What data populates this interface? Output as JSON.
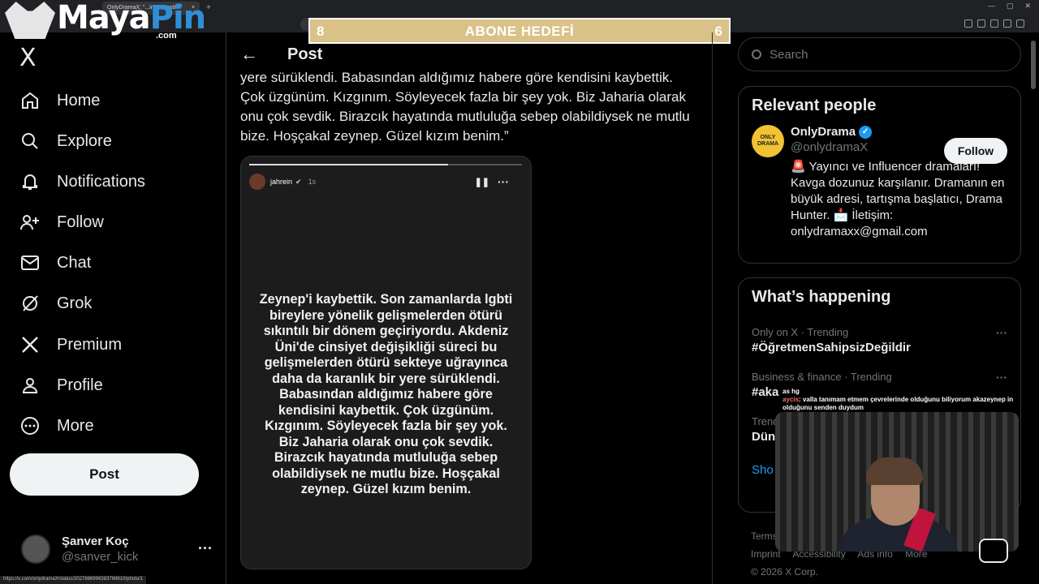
{
  "browser": {
    "tab_title": "OnlyDramaX: \"...in, travesti...\"",
    "tab_close": "×",
    "new_tab": "+",
    "status_url": "https://x.com/onlydramaX/status/2027886996383768810/photo/1"
  },
  "overlay": {
    "brand_word_a": "Maya",
    "brand_word_b": "Pin",
    "brand_domain": ".com",
    "goal_left": "8",
    "goal_title": "ABONE HEDEFİ",
    "goal_right": "6"
  },
  "nav": {
    "logo": "X",
    "items": [
      {
        "label": "Home",
        "icon": "home-icon"
      },
      {
        "label": "Explore",
        "icon": "search-icon"
      },
      {
        "label": "Notifications",
        "icon": "bell-icon"
      },
      {
        "label": "Follow",
        "icon": "person-plus-icon"
      },
      {
        "label": "Chat",
        "icon": "mail-icon"
      },
      {
        "label": "Grok",
        "icon": "grok-icon"
      },
      {
        "label": "Premium",
        "icon": "x-premium-icon"
      },
      {
        "label": "Profile",
        "icon": "person-icon"
      },
      {
        "label": "More",
        "icon": "more-circle-icon"
      }
    ],
    "post_button": "Post",
    "account": {
      "name": "Şanver Koç",
      "handle": "@sanver_kick",
      "menu": "···"
    }
  },
  "post": {
    "back": "←",
    "title": "Post",
    "text": "yere sürüklendi. Babasından aldığımız habere göre kendisini kaybettik. Çok üzgünüm. Kızgınım. Söyleyecek fazla bir şey yok. Biz Jaharia olarak onu çok sevdik. Birazcık hayatında mutluluğa sebep olabildiysek ne mutlu bize. Hoşçakal zeynep. Güzel kızım benim.”",
    "story": {
      "progress": 0.73,
      "username": "jahrein",
      "verified": "✔",
      "time": "1s",
      "pause": "❚❚",
      "menu": "···",
      "message": "Zeynep'i kaybettik. Son zamanlarda lgbti bireylere yönelik gelişmelerden ötürü sıkıntılı bir dönem geçiriyordu. Akdeniz Üni'de cinsiyet değişikliği süreci bu gelişmelerden ötürü sekteye uğrayınca daha da karanlık bir yere sürüklendi. Babasından aldığımız habere göre kendisini kaybettik. Çok üzgünüm. Kızgınım. Söyleyecek fazla bir şey yok. Biz Jaharia olarak onu çok sevdik. Birazcık hayatında mutluluğa sebep olabildiysek ne mutlu bize. Hoşçakal zeynep. Güzel kızım benim."
    }
  },
  "sidebar": {
    "search_placeholder": "Search",
    "relevant_title": "Relevant people",
    "person": {
      "avatar_text": "ONLY DRAMA",
      "name": "OnlyDrama",
      "verified": "✓",
      "handle": "@onlydramaX",
      "follow": "Follow",
      "bio": "🚨 Yayıncı ve Influencer dramaları! Kavga dozunuz karşılanır. Dramanın en büyük adresi, tartışma başlatıcı, Drama Hunter. 📩 İletişim: onlydramaxx@gmail.com"
    },
    "happening_title": "What’s happening",
    "trends": [
      {
        "meta": "Only on X · Trending",
        "topic": "#ÖğretmenSahipsizDeğildir",
        "menu": "···"
      },
      {
        "meta": "Business & finance · Trending",
        "topic": "#aka",
        "menu": "···"
      },
      {
        "meta": "Trend",
        "topic": "Dün",
        "menu": ""
      }
    ],
    "show_more": "Sho",
    "footer": [
      "Terms",
      "Imprint",
      "Accessibility",
      "Ads info",
      "More",
      "© 2026 X Corp."
    ]
  },
  "stream_chat": {
    "user": "aycis",
    "message": ": valla tanımam etmem çevrelerinde olduğunu biliyorum akazeynep in olduğunu senden duydum",
    "faded": "as hg"
  }
}
